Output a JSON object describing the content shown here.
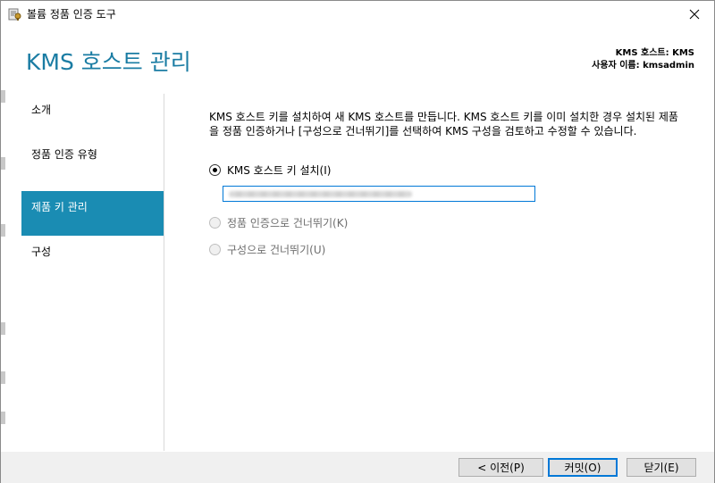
{
  "window": {
    "title": "볼륨 정품 인증 도구",
    "close_label": "✕"
  },
  "header": {
    "page_title": "KMS 호스트 관리",
    "host_label": "KMS 호스트: KMS",
    "user_label": "사용자 이름: kmsadmin"
  },
  "nav": {
    "items": [
      {
        "label": "소개",
        "active": false
      },
      {
        "label": "정품 인증 유형",
        "active": false
      },
      {
        "label": "제품 키 관리",
        "active": true
      },
      {
        "label": "구성",
        "active": false
      }
    ]
  },
  "main": {
    "description": "KMS 호스트 키를 설치하여 새 KMS 호스트를 만듭니다. KMS 호스트 키를 이미 설치한 경우 설치된 제품을 정품 인증하거나 [구성으로 건너뛰기]를 선택하여 KMS 구성을 검토하고 수정할 수 있습니다.",
    "options": [
      {
        "label": "KMS 호스트 키 설치(I)",
        "checked": true,
        "enabled": true
      },
      {
        "label": "정품 인증으로 건너뛰기(K)",
        "checked": false,
        "enabled": false
      },
      {
        "label": "구성으로 건너뛰기(U)",
        "checked": false,
        "enabled": false
      }
    ],
    "key_value": ""
  },
  "footer": {
    "back_label": "< 이전(P)",
    "commit_label": "커밋(O)",
    "close_label": "닫기(E)"
  },
  "colors": {
    "accent": "#1a7ca3",
    "nav_active": "#1a8cb3"
  },
  "icons": {
    "app": "volume-activation-icon",
    "close": "close-icon"
  }
}
